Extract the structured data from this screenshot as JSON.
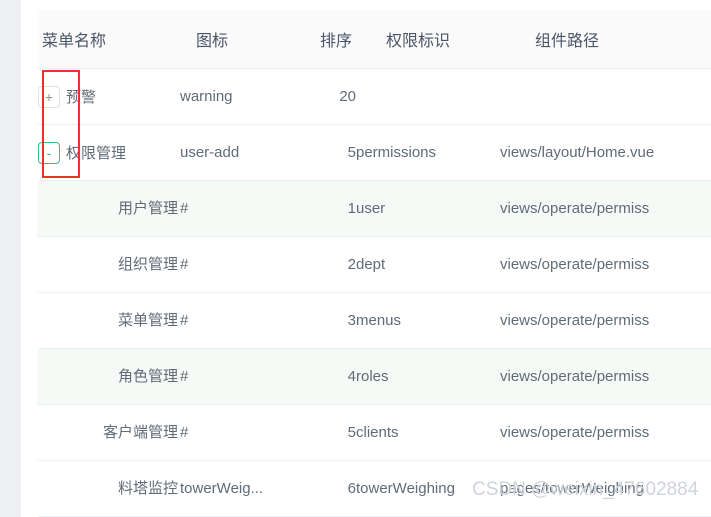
{
  "table": {
    "columns": [
      {
        "key": "name",
        "label": "菜单名称"
      },
      {
        "key": "icon",
        "label": "图标"
      },
      {
        "key": "sort",
        "label": "排序"
      },
      {
        "key": "perm",
        "label": "权限标识"
      },
      {
        "key": "path",
        "label": "组件路径"
      }
    ],
    "rows": [
      {
        "name": "预警",
        "icon": "warning",
        "sort": "20",
        "perm": "",
        "path": "",
        "level": 0,
        "expander": "+",
        "expanded": false,
        "stripe": false
      },
      {
        "name": "权限管理",
        "icon": "user-add",
        "sort": "5",
        "perm": "permissions",
        "path": "views/layout/Home.vue",
        "level": 0,
        "expander": "-",
        "expanded": true,
        "stripe": false
      },
      {
        "name": "用户管理",
        "icon": "#",
        "sort": "1",
        "perm": "user",
        "path": "views/operate/permiss",
        "level": 1,
        "expander": "",
        "expanded": false,
        "stripe": true
      },
      {
        "name": "组织管理",
        "icon": "#",
        "sort": "2",
        "perm": "dept",
        "path": "views/operate/permiss",
        "level": 1,
        "expander": "",
        "expanded": false,
        "stripe": false
      },
      {
        "name": "菜单管理",
        "icon": "#",
        "sort": "3",
        "perm": "menus",
        "path": "views/operate/permiss",
        "level": 1,
        "expander": "",
        "expanded": false,
        "stripe": false
      },
      {
        "name": "角色管理",
        "icon": "#",
        "sort": "4",
        "perm": "roles",
        "path": "views/operate/permiss",
        "level": 1,
        "expander": "",
        "expanded": false,
        "stripe": true
      },
      {
        "name": "客户端管理",
        "icon": "#",
        "sort": "5",
        "perm": "clients",
        "path": "views/operate/permiss",
        "level": 1,
        "expander": "",
        "expanded": false,
        "stripe": false
      },
      {
        "name": "料塔监控",
        "icon": "towerWeig...",
        "sort": "6",
        "perm": "towerWeighing",
        "path": "pages/towerWeighing",
        "level": 1,
        "expander": "",
        "expanded": false,
        "stripe": false
      }
    ]
  },
  "annotation": {
    "color": "#e8322a"
  },
  "watermark": {
    "text": "CSDN @weixin_47602884"
  },
  "colors": {
    "page_background": "#eff0f4",
    "card_background": "#ffffff",
    "header_background": "#fafafa",
    "stripe_background": "#f5faf6",
    "text": "#606b77",
    "header_text": "#4a5568",
    "border": "#ebeef3",
    "expander_open_border": "#42b983",
    "expander_closed_border": "#dcdfe6",
    "annotation": "#e8322a",
    "watermark": "#cfd3da"
  }
}
